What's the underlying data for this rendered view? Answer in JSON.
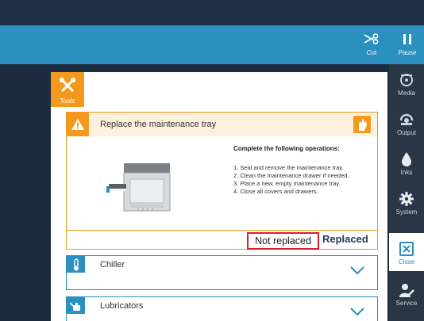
{
  "toolbar": {
    "cut_label": "Cut",
    "pause_label": "Pause"
  },
  "sidebar": {
    "items": [
      {
        "label": "Media",
        "icon": "media-roll-icon"
      },
      {
        "label": "Output",
        "icon": "output-icon"
      },
      {
        "label": "Inks",
        "icon": "ink-drop-icon"
      },
      {
        "label": "System",
        "icon": "gear-icon"
      },
      {
        "label": "Close",
        "icon": "close-icon"
      },
      {
        "label": "Service",
        "icon": "service-person-icon"
      }
    ]
  },
  "tools_tab": {
    "label": "Tools",
    "icon": "wrench-screwdriver-icon"
  },
  "maintenance": {
    "title": "Replace the maintenance tray",
    "ops_title": "Complete the following operations:",
    "operations": [
      "1. Seal and remove the maintenance tray.",
      "2. Clean the maintenance drawer if needed.",
      "3. Place a new, empty maintenance tray.",
      "4. Close all covers and drawers."
    ],
    "not_replaced_label": "Not replaced",
    "replaced_label": "Replaced"
  },
  "accordions": [
    {
      "title": "Chiller",
      "icon": "thermometer-icon"
    },
    {
      "title": "Lubricators",
      "icon": "oil-can-icon"
    }
  ],
  "colors": {
    "accent_blue": "#2b8fc0",
    "accent_orange": "#f39a1e",
    "highlight_red": "#d91f2b",
    "dark_navy": "#1d2e45"
  }
}
